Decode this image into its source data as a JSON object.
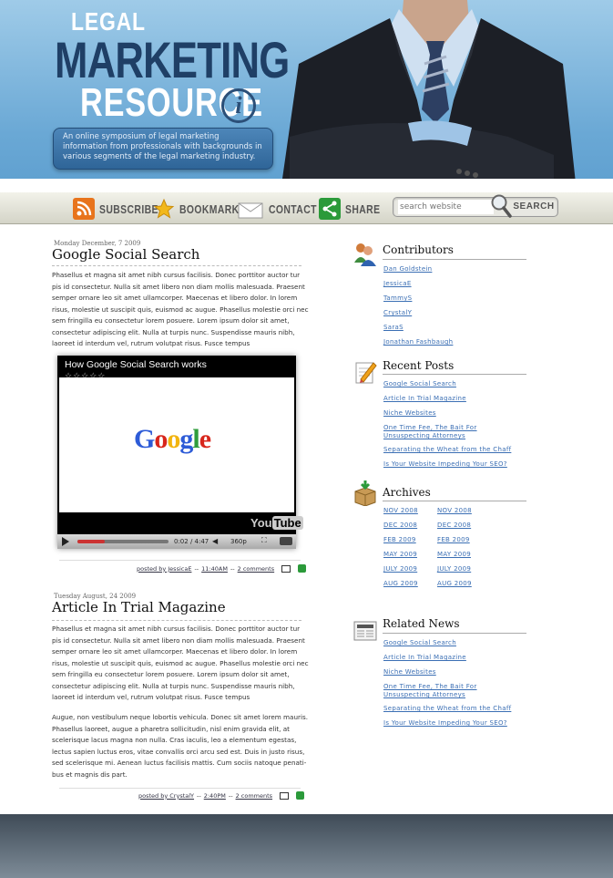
{
  "header": {
    "logo_line1": "LEGAL",
    "logo_line2": "MARKETING",
    "logo_line3": "RESOURCE",
    "logo_icon": "i",
    "tagline": "An online symposium of legal marketing information from professionals with backgrounds in various segments of the legal marketing industry."
  },
  "nav": {
    "subscribe": "SUBSCRIBE",
    "bookmark": "BOOKMARK",
    "contact": "CONTACT",
    "share": "SHARE",
    "search_placeholder": "search website",
    "search_button": "SEARCH"
  },
  "posts": [
    {
      "date": "Monday December, 7 2009",
      "title": "Google Social Search",
      "body": [
        "Phasellus et magna sit amet nibh cursus facilisis. Donec porttitor auctor tur pis id consectetur. Nulla sit amet libero non diam mollis malesuada. Praesent semper ornare leo sit amet ullamcorper. Maecenas et libero dolor. In lorem risus, molestie ut suscipit quis, euismod ac augue. Phasellus molestie orci nec sem fringilla eu consectetur lorem posuere. Lorem ipsum dolor sit amet, consectetur adipiscing elit. Nulla at turpis nunc. Suspendisse mauris nibh, laoreet id interdum vel, rutrum volutpat risus. Fusce tempus"
      ],
      "video": {
        "title": "How Google Social Search works",
        "stars": "☆☆☆☆☆",
        "logo": "Google",
        "brand_you": "You",
        "brand_tube": "Tube",
        "time": "0:02 / 4:47",
        "quality": "360p"
      },
      "footer": {
        "posted_by": "posted by JessicaE",
        "sep": "--",
        "time": "11:40AM",
        "comments": "2 comments"
      }
    },
    {
      "date": "Tuesday August, 24 2009",
      "title": "Article In Trial Magazine",
      "body": [
        "Phasellus et magna sit amet nibh cursus facilisis. Donec porttitor auctor tur pis id consectetur. Nulla sit amet libero non diam mollis malesuada. Praesent semper ornare leo sit amet ullamcorper. Maecenas et libero dolor. In lorem risus, molestie ut suscipit quis, euismod ac augue. Phasellus molestie orci nec sem fringilla eu consectetur lorem posuere. Lorem ipsum dolor sit amet, consectetur adipiscing elit. Nulla at turpis nunc. Suspendisse mauris nibh, laoreet id interdum vel, rutrum volutpat risus. Fusce tempus",
        "Augue, non vestibulum neque lobortis vehicula. Donec sit amet lorem mauris. Phasellus laoreet, augue a pharetra sollicitudin, nisl enim gravida elit, at scelerisque lacus magna non nulla. Cras iaculis, leo a elementum egestas, lectus sapien luctus eros, vitae convallis orci arcu sed est. Duis in justo risus, sed scelerisque mi. Aenean luctus facilisis mattis. Cum sociis natoque penati-bus et magnis dis part."
      ],
      "footer": {
        "posted_by": "posted by CrystalY",
        "sep": "--",
        "time": "2:40PM",
        "comments": "2 comments"
      }
    }
  ],
  "sidebar": {
    "contributors": {
      "title": "Contributors",
      "items": [
        "Dan Goldstein",
        "JessicaE",
        "TammyS",
        "CrystalY",
        "SaraS",
        "Jonathan Fashbaugh"
      ]
    },
    "recent": {
      "title": "Recent Posts",
      "items": [
        "Google Social Search",
        "Article In Trial Magazine",
        "Niche Websites",
        "One Time Fee, The Bait For",
        "Unsuspecting Attorneys",
        "Separating the Wheat from the Chaff",
        "Is Your Website Impeding Your SEO?"
      ]
    },
    "archives": {
      "title": "Archives",
      "col1": [
        "NOV 2008",
        "DEC 2008",
        "FEB 2009",
        "MAY 2009",
        "JULY 2009",
        "AUG 2009"
      ],
      "col2": [
        "NOV 2008",
        "DEC 2008",
        "FEB 2009",
        "MAY 2009",
        "JULY 2009",
        "AUG 2009"
      ]
    },
    "related": {
      "title": "Related News",
      "items": [
        "Google Social Search",
        "Article In Trial Magazine",
        "Niche Websites",
        "One Time Fee, The Bait For",
        "Unsuspecting Attorneys",
        "Separating the Wheat from the Chaff",
        "Is Your Website Impeding Your SEO?"
      ]
    }
  },
  "colors": {
    "accent": "#3b6fb4",
    "header_bg": "#6aa8d5",
    "logo_dark": "#1f3f66"
  }
}
